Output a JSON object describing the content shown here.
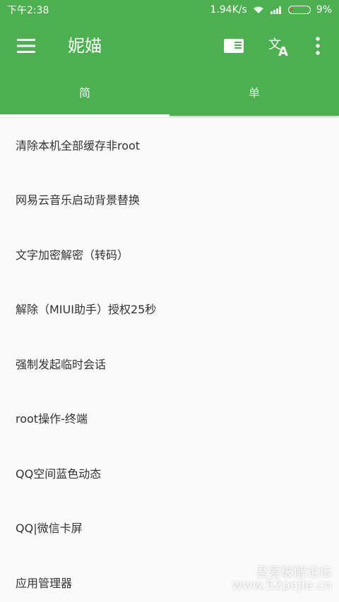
{
  "status_bar": {
    "time": "下午2:38",
    "speed": "1.94K/s",
    "battery": "9%"
  },
  "app_bar": {
    "title": "妮媌",
    "icons": [
      "menu-icon",
      "reader-icon",
      "translate-icon",
      "more-vert-icon"
    ]
  },
  "tabs": [
    {
      "label": "简",
      "active": true
    },
    {
      "label": "单",
      "active": false
    }
  ],
  "list": {
    "items": [
      "清除本机全部缓存非root",
      "网易云音乐启动背景替换",
      "文字加密解密（转码）",
      "解除（MIUI助手）授权25秒",
      "强制发起临时会话",
      "root操作-终端",
      "QQ空间蓝色动态",
      "QQ|微信卡屏",
      "应用管理器"
    ]
  },
  "watermark": {
    "line1": "吾爱破解论坛",
    "line2": "www.52pojie.cn"
  },
  "colors": {
    "primary": "#4caf50",
    "background": "#fafafa",
    "text": "#333333"
  }
}
